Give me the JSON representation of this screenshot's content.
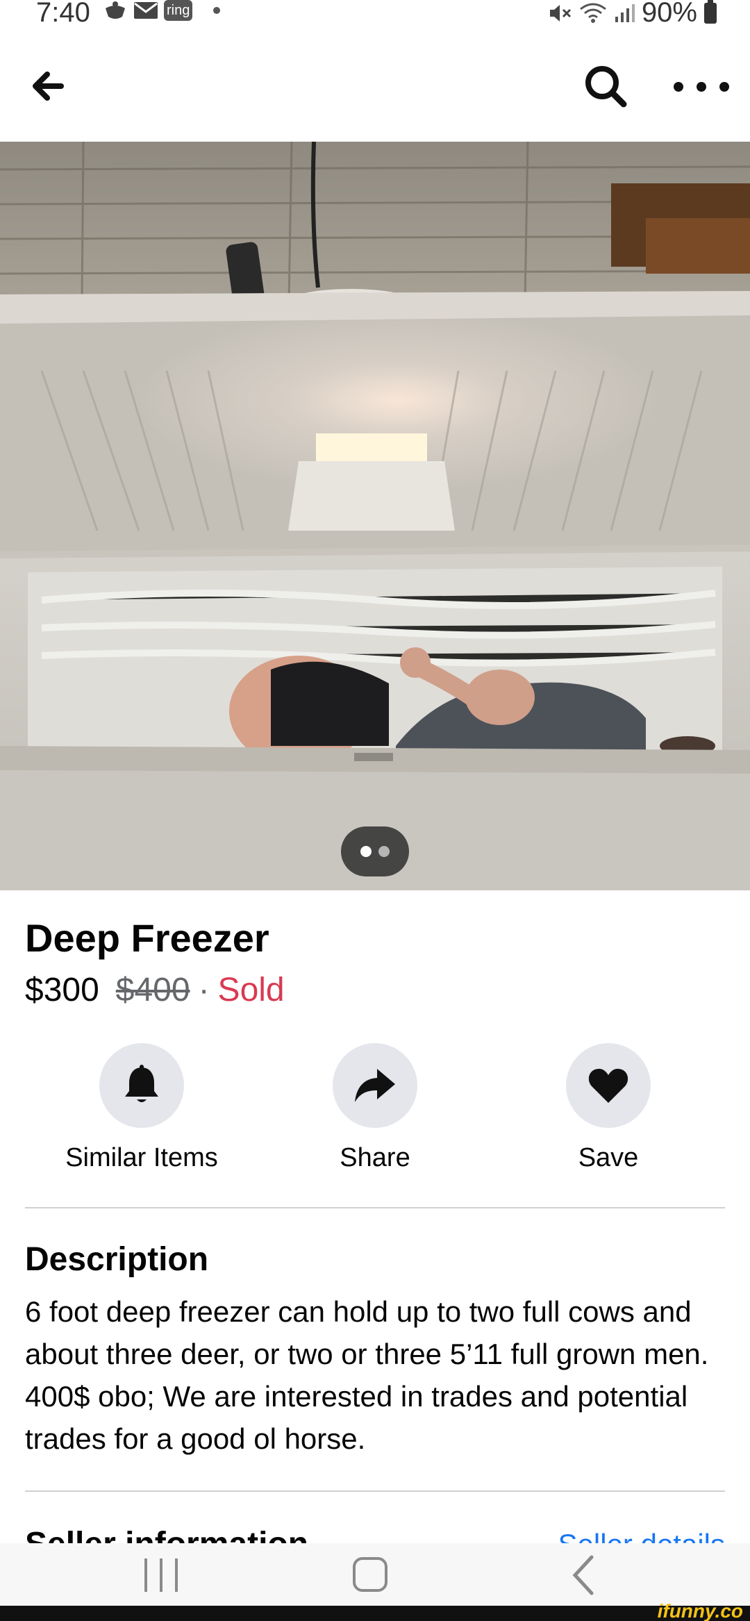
{
  "status_bar": {
    "time": "7:40",
    "ring_label": "ring",
    "battery": "90%",
    "icons": [
      "voicemail-icon",
      "mail-icon",
      "ring-app-icon",
      "notification-dot-icon",
      "mute-icon",
      "wifi-icon",
      "signal-icon",
      "battery-icon"
    ]
  },
  "nav": {
    "back_icon": "arrow-left-icon",
    "search_icon": "search-icon",
    "more_icon": "more-dots-icon"
  },
  "photo": {
    "description_icon": "listing-photo",
    "pager": {
      "count": 2,
      "active_index": 0
    }
  },
  "listing": {
    "title": "Deep Freezer",
    "price": "$300",
    "original_price": "$400",
    "separator": "·",
    "status": "Sold",
    "status_color": "#d83a52"
  },
  "actions": [
    {
      "label": "Similar Items",
      "icon": "bell-icon"
    },
    {
      "label": "Share",
      "icon": "share-arrow-icon"
    },
    {
      "label": "Save",
      "icon": "heart-icon"
    }
  ],
  "description": {
    "heading": "Description",
    "text": "6 foot deep freezer can hold up to two full cows and about three deer, or two or three 5’11 full grown men.  400$ obo; We are interested in trades and potential trades for a good ol horse."
  },
  "seller": {
    "heading": "Seller information",
    "link": "Seller details",
    "link_color": "#1877f2"
  },
  "system_nav": {
    "recent_icon": "recent-apps-icon",
    "home_icon": "home-icon",
    "back_icon": "system-back-icon"
  },
  "watermark": "ifunny.co"
}
